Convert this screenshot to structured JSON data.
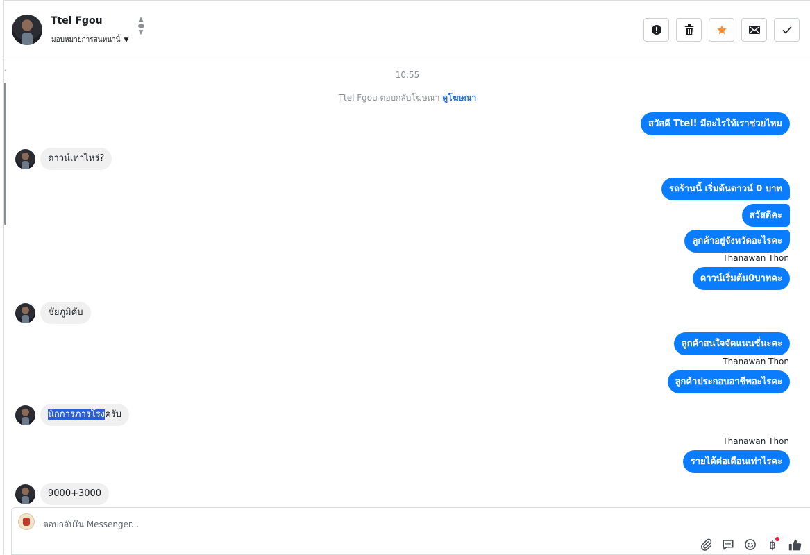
{
  "header": {
    "contact_name": "Ttel Fgou",
    "assign_label": "มอบหมายการสนทนานี้",
    "actions": [
      {
        "name": "mark-spam",
        "icon": "exclamation-icon"
      },
      {
        "name": "delete",
        "icon": "trash-icon"
      },
      {
        "name": "star",
        "icon": "star-icon",
        "color": "#f7923a"
      },
      {
        "name": "mark-unread",
        "icon": "envelope-icon"
      },
      {
        "name": "mark-done",
        "icon": "check-icon"
      }
    ]
  },
  "conversation": {
    "timestamp": "10:55",
    "notice_prefix": "Ttel Fgou ตอบกลับโฆษณา",
    "notice_link": "ดูโฆษณา",
    "messages": {
      "out_1": "สวัสดี Ttel! มีอะไรให้เราช่วยไหม",
      "in_1": "ดาวน์เท่าไหร่?",
      "out_2": "รถร้านนี้ เริ่มต้นดาวน์ 0 บาท",
      "out_3": "สวัสดีคะ",
      "out_4": "ลูกค้าอยู่จังหวัดอะไรคะ",
      "sender_1": "Thanawan Thon",
      "out_5": "ดาวน์เริ่มต้น0บาทคะ",
      "in_2": "ชัยภูมิคับ",
      "out_6": "ลูกค้าสนใจจัดแนนชั่นะคะ",
      "sender_2": "Thanawan Thon",
      "out_7": "ลูกค้าประกอบอาชีพอะไรคะ",
      "in_3_selected": "นักการภารโรง",
      "in_3_rest": "ครับ",
      "sender_3": "Thanawan Thon",
      "out_8": "รายได้ต่อเดือนเท่าไรคะ",
      "in_4": "9000+3000"
    }
  },
  "composer": {
    "placeholder": "ตอบกลับใน Messenger...",
    "tools": [
      "paperclip-icon",
      "saved-reply-icon",
      "emoji-icon",
      "baht-icon",
      "thumbs-up-icon"
    ]
  },
  "colors": {
    "outgoing_bubble": "#0a7cff",
    "incoming_bubble": "#f0f0f0",
    "link": "#216fdb"
  }
}
